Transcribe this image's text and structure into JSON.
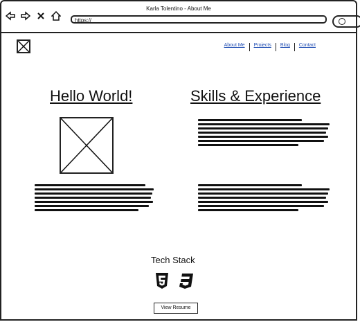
{
  "window": {
    "title": "Karla Tolentino - About Me"
  },
  "address_bar": {
    "url": "https://"
  },
  "nav": {
    "about": "About Me",
    "projects": "Projects",
    "blog": "Blog",
    "contact": "Contact"
  },
  "hero": {
    "left_title": "Hello World!",
    "right_title": "Skills & Experience"
  },
  "tech": {
    "title": "Tech Stack"
  },
  "button": {
    "label": "View Resume"
  },
  "icons": {
    "back": "back-arrow-icon",
    "forward": "forward-arrow-icon",
    "close": "close-icon",
    "home": "home-icon",
    "search": "search-icon",
    "html5": "html5-icon",
    "css3": "css3-icon"
  }
}
